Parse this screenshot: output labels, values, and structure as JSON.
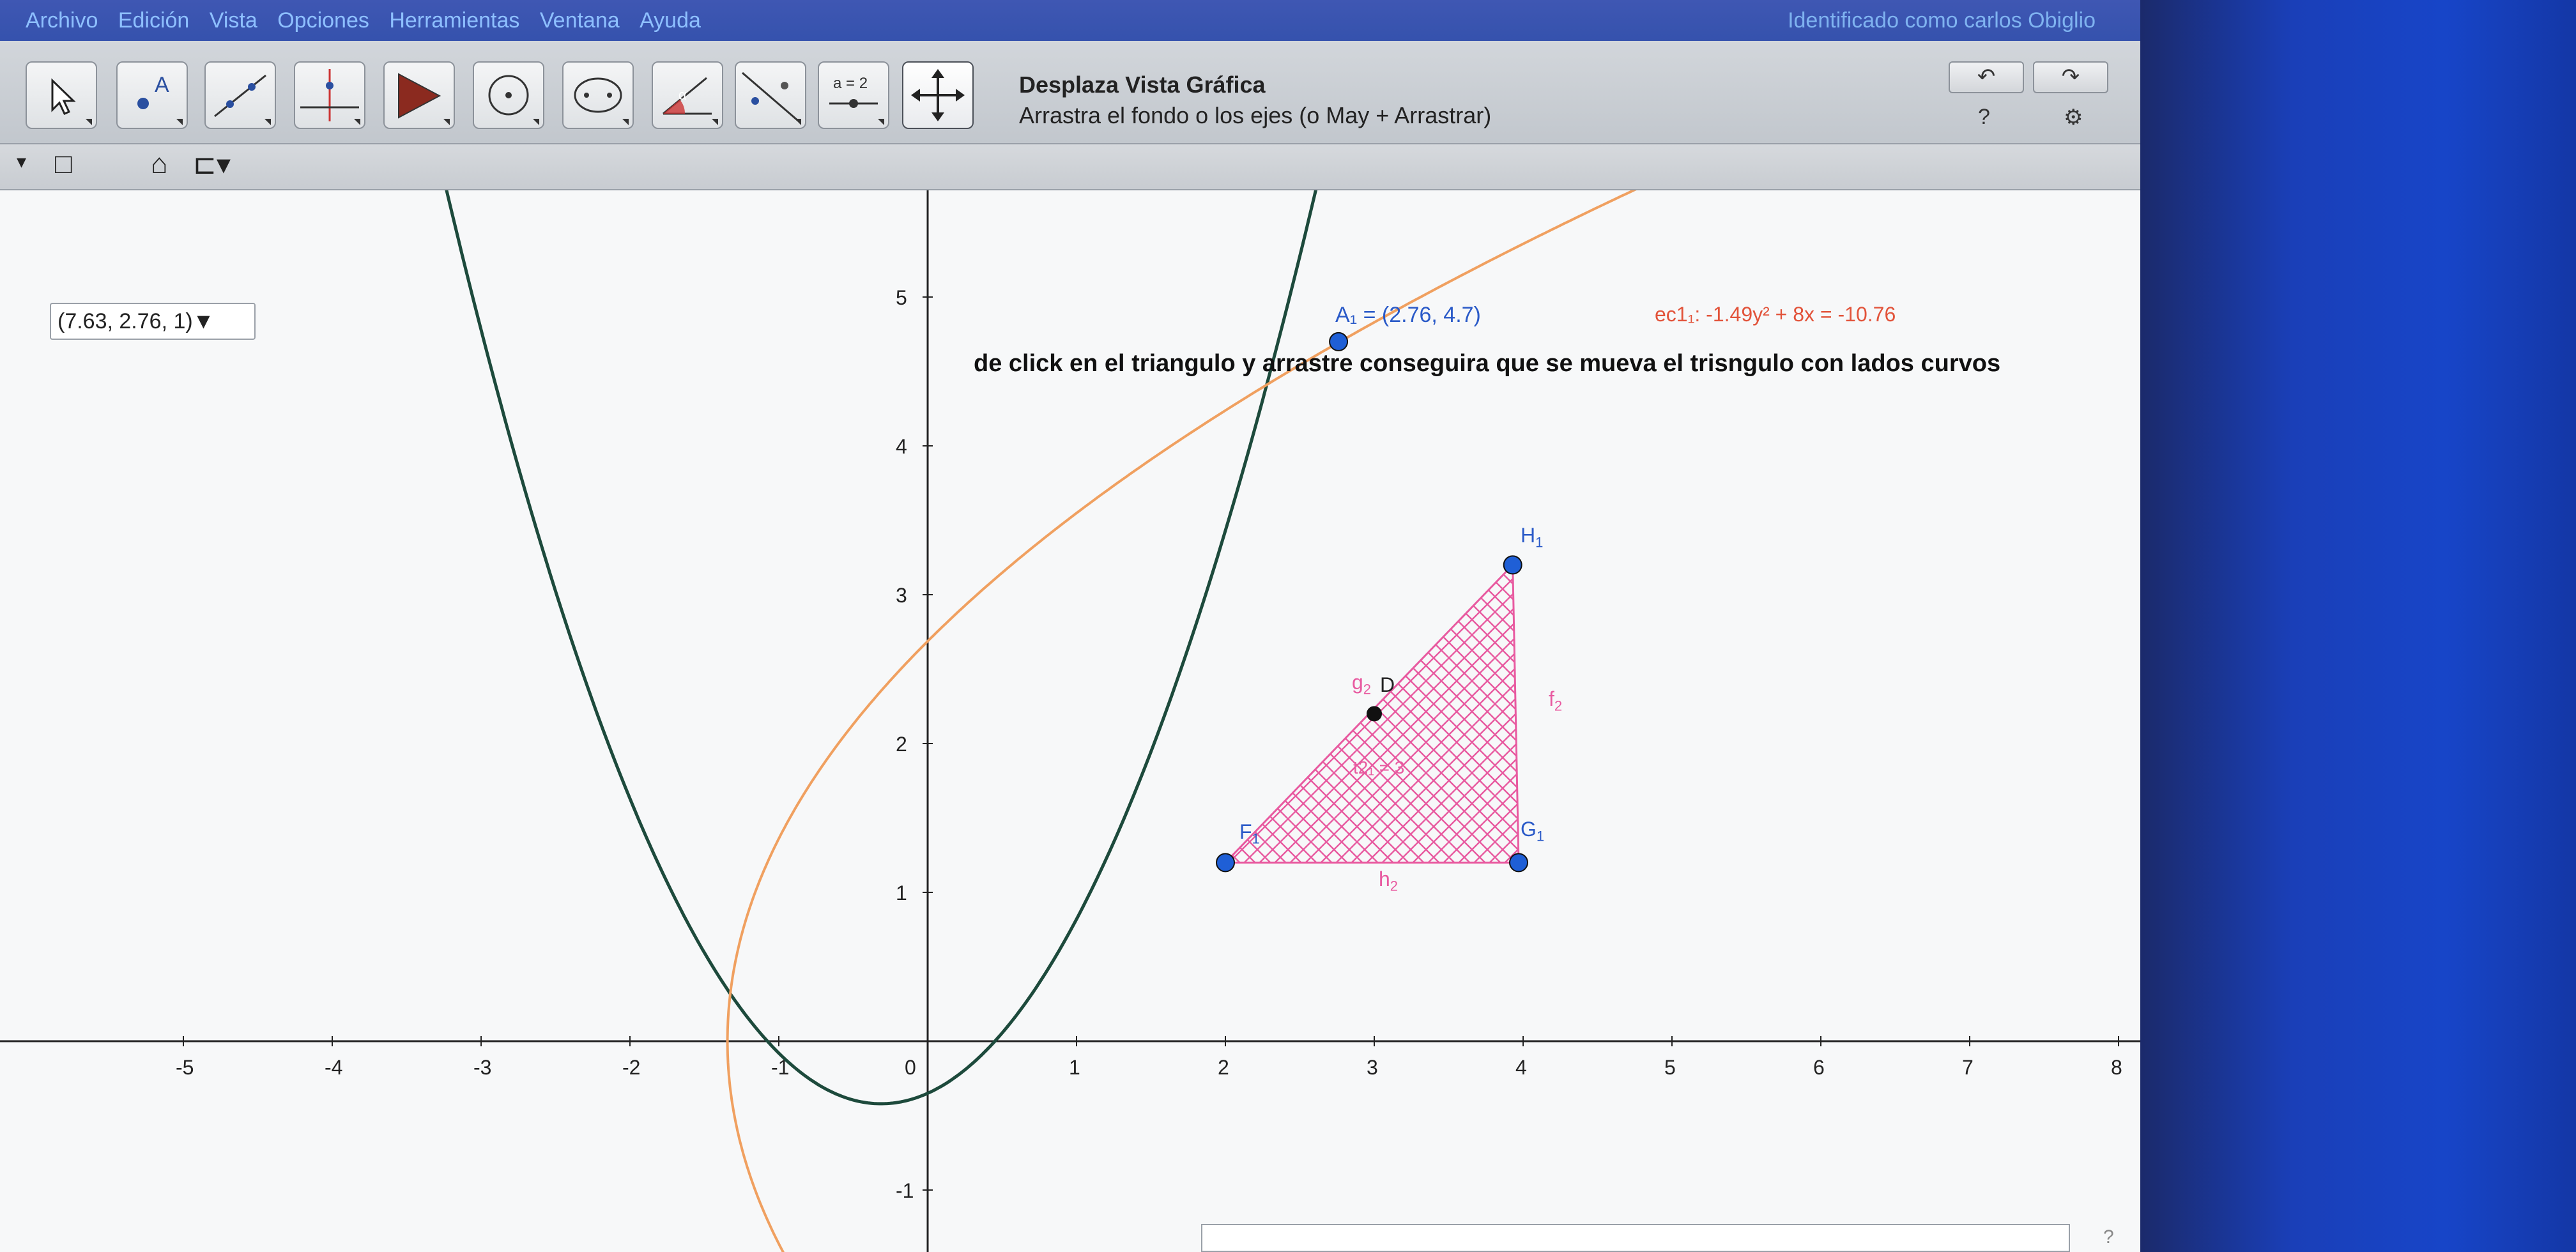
{
  "menubar": {
    "items": [
      "Archivo",
      "Edición",
      "Vista",
      "Opciones",
      "Herramientas",
      "Ventana",
      "Ayuda"
    ],
    "login_status": "Identificado como carlos Obiglio"
  },
  "toolbar": {
    "tools": [
      {
        "name": "move-tool",
        "icon": "cursor-arrow-icon"
      },
      {
        "name": "point-tool",
        "icon": "point-a-icon",
        "glyph": "A"
      },
      {
        "name": "line-tool",
        "icon": "line-through-points-icon"
      },
      {
        "name": "perpendicular-tool",
        "icon": "perpendicular-line-icon"
      },
      {
        "name": "polygon-tool",
        "icon": "polygon-icon"
      },
      {
        "name": "circle-tool",
        "icon": "circle-center-point-icon"
      },
      {
        "name": "conic-tool",
        "icon": "ellipse-icon"
      },
      {
        "name": "angle-tool",
        "icon": "angle-icon",
        "glyph": "α"
      },
      {
        "name": "reflect-tool",
        "icon": "reflect-about-line-icon"
      },
      {
        "name": "slider-tool",
        "icon": "slider-icon",
        "glyph": "a = 2"
      },
      {
        "name": "move-graphics-view-tool",
        "icon": "move-view-icon",
        "active": true
      }
    ],
    "active_tool_title": "Desplaza Vista Gráfica",
    "active_tool_help": "Arrastra el fondo o los ejes (o May + Arrastrar)",
    "undo_label": "↶",
    "redo_label": "↷",
    "help_glyph": "?",
    "settings_glyph": "⚙"
  },
  "stylebar": {
    "toggle_glyph": "▾",
    "axes_glyph": "□",
    "home_glyph": "⌂",
    "capture_glyph": "⊏▾"
  },
  "graphics": {
    "point_popup": "(7.63, 2.76, 1)▼",
    "instruction": "de click en el triangulo y arrastre conseguira que se mueva el trisngulo con lados curvos",
    "point_a1_label": "A₁ = (2.76, 4.7)",
    "ec1_label": "ec1₁: -1.49y² + 8x = -10.76",
    "labels": {
      "H": "H",
      "G": "G",
      "F": "F",
      "D": "D",
      "g": "g",
      "f": "f",
      "h": "h",
      "sub1": "1",
      "sub2": "2",
      "region": "t2₁ = 3"
    }
  },
  "chart_data": {
    "type": "line",
    "title": "",
    "x_ticks": [
      -5,
      -4,
      -3,
      -2,
      -1,
      0,
      1,
      2,
      3,
      4,
      5,
      6,
      7,
      8
    ],
    "y_ticks": [
      -1,
      1,
      2,
      3,
      4,
      5
    ],
    "xlim": [
      -6.2,
      8.3
    ],
    "ylim": [
      -1.4,
      5.75
    ],
    "grid": false,
    "series": [
      {
        "name": "parabola",
        "color": "#1d4a3c",
        "expr": "y = 0.72x² + 0.45x - 0.35"
      },
      {
        "name": "ec1",
        "color": "#f0a060",
        "expr": "-1.49y² + 8x = -10.76"
      }
    ],
    "points": [
      {
        "label": "A1",
        "x": 2.76,
        "y": 4.7,
        "color": "#1f5fd6"
      },
      {
        "label": "H1",
        "x": 3.93,
        "y": 3.2,
        "color": "#1f5fd6"
      },
      {
        "label": "F1",
        "x": 2.0,
        "y": 1.2,
        "color": "#1f5fd6"
      },
      {
        "label": "G1",
        "x": 3.97,
        "y": 1.2,
        "color": "#1f5fd6"
      },
      {
        "label": "D",
        "x": 3.0,
        "y": 2.2,
        "color": "#111111"
      }
    ],
    "triangle": {
      "vertices": [
        "F1",
        "G1",
        "H1"
      ],
      "fill": "#e85aa0",
      "pattern": "crosshatch"
    }
  }
}
